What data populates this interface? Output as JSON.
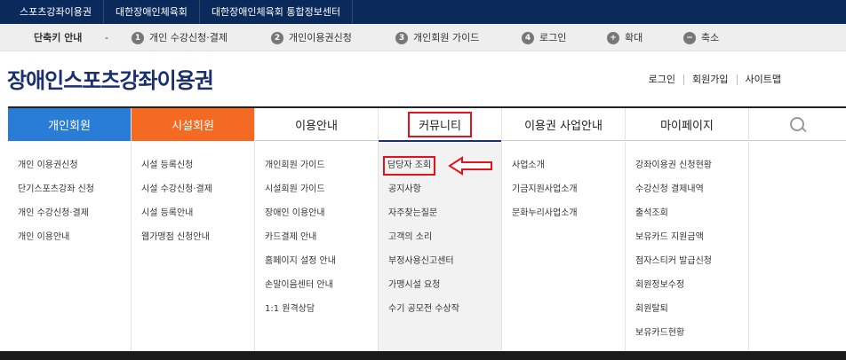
{
  "top_links": [
    "스포츠강좌이용권",
    "대한장애인체육회",
    "대한장애인체육회 통합정보센터"
  ],
  "shortcut": {
    "title": "단축키 안내",
    "dash": "-",
    "items": [
      {
        "num": "1",
        "label": "개인 수강신청·결제"
      },
      {
        "num": "2",
        "label": "개인이용권신청"
      },
      {
        "num": "3",
        "label": "개인회원 가이드"
      },
      {
        "num": "4",
        "label": "로그인"
      },
      {
        "num": "+",
        "label": "확대"
      },
      {
        "num": "−",
        "label": "축소"
      }
    ]
  },
  "logo": "장애인스포츠강좌이용권",
  "util_links": [
    "로그인",
    "회원가입",
    "사이트맵"
  ],
  "gnb": [
    "개인회원",
    "시설회원",
    "이용안내",
    "커뮤니티",
    "이용권 사업안내",
    "마이페이지"
  ],
  "icons": {
    "search": "search-icon",
    "arrow": "left-arrow-icon"
  },
  "colors": {
    "top_bar": "#0b2a5c",
    "personal": "#2a7dd6",
    "facility": "#f46a23",
    "highlight": "#e4121b"
  },
  "menus": {
    "personal": [
      "개인 이용권신청",
      "단기스포츠강좌 신청",
      "개인 수강신청·결제",
      "개인 이용안내"
    ],
    "facility": [
      "시설 등록신청",
      "시설 수강신청·결제",
      "시설 등록안내",
      "웹가맹점 신청안내"
    ],
    "guide": [
      "개인회원 가이드",
      "시설회원 가이드",
      "장애인 이용안내",
      "카드결제 안내",
      "홈페이지 설정 안내",
      "손말이음센터 안내",
      "1:1 원격상담"
    ],
    "community": [
      "담당자 조회",
      "공지사항",
      "자주찾는질문",
      "고객의 소리",
      "부정사용신고센터",
      "가맹시설 요청",
      "수기 공모전 수상작"
    ],
    "business": [
      "사업소개",
      "기금지원사업소개",
      "문화누리사업소개"
    ],
    "mypage": [
      "강좌이용권 신청현황",
      "수강신청 결제내역",
      "출석조회",
      "보유카드 지원금액",
      "점자스티커 발급신청",
      "회원정보수정",
      "회원탈퇴",
      "보유카드현황"
    ]
  }
}
